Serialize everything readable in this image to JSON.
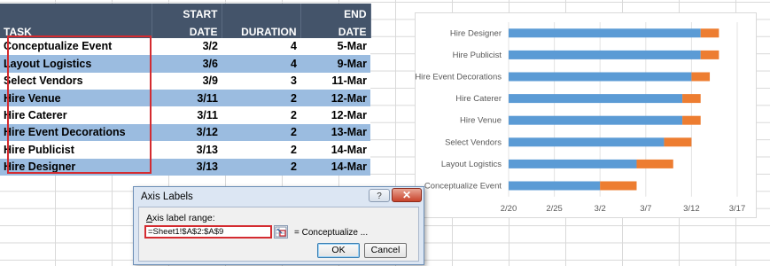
{
  "table": {
    "headers": [
      {
        "line1": "",
        "line2": "TASK"
      },
      {
        "line1": "START",
        "line2": "DATE"
      },
      {
        "line1": "",
        "line2": "DURATION"
      },
      {
        "line1": "END",
        "line2": "DATE"
      }
    ],
    "rows": [
      {
        "task": "Conceptualize Event",
        "start": "3/2",
        "duration": "4",
        "end": "5-Mar"
      },
      {
        "task": "Layout Logistics",
        "start": "3/6",
        "duration": "4",
        "end": "9-Mar"
      },
      {
        "task": "Select Vendors",
        "start": "3/9",
        "duration": "3",
        "end": "11-Mar"
      },
      {
        "task": "Hire Venue",
        "start": "3/11",
        "duration": "2",
        "end": "12-Mar"
      },
      {
        "task": "Hire Caterer",
        "start": "3/11",
        "duration": "2",
        "end": "12-Mar"
      },
      {
        "task": "Hire Event Decorations",
        "start": "3/12",
        "duration": "2",
        "end": "13-Mar"
      },
      {
        "task": "Hire Publicist",
        "start": "3/13",
        "duration": "2",
        "end": "14-Mar"
      },
      {
        "task": "Hire Designer",
        "start": "3/13",
        "duration": "2",
        "end": "14-Mar"
      }
    ]
  },
  "colors": {
    "header_bg": "#44546a",
    "band_bg": "#9bbce0",
    "highlight": "#d42b30",
    "bar_blue": "#5b9bd5",
    "bar_orange": "#ed7d31"
  },
  "chart_data": {
    "type": "bar",
    "orientation": "horizontal",
    "stacked": true,
    "categories": [
      "Hire Designer",
      "Hire Publicist",
      "Hire Event Decorations",
      "Hire Caterer",
      "Hire Venue",
      "Select Vendors",
      "Layout Logistics",
      "Conceptualize Event"
    ],
    "series": [
      {
        "values": [
          "3/13",
          "3/13",
          "3/12",
          "3/11",
          "3/11",
          "3/9",
          "3/6",
          "3/2"
        ],
        "color": "#5b9bd5"
      },
      {
        "values": [
          2,
          2,
          2,
          2,
          2,
          3,
          4,
          4
        ],
        "color": "#ed7d31"
      }
    ],
    "x_tick_labels": [
      "2/20",
      "2/25",
      "3/2",
      "3/7",
      "3/12",
      "3/17"
    ],
    "x_range": [
      "2/20",
      "3/17"
    ]
  },
  "dialog": {
    "title": "Axis Labels",
    "help_label": "?",
    "close_label": "✕",
    "range_label_accel": "A",
    "range_label_rest": "xis label range:",
    "range_value": "=Sheet1!$A$2:$A$9",
    "preview": "= Conceptualize ...",
    "ok_label": "OK",
    "cancel_label": "Cancel",
    "ref_icon": "range-select-icon"
  }
}
